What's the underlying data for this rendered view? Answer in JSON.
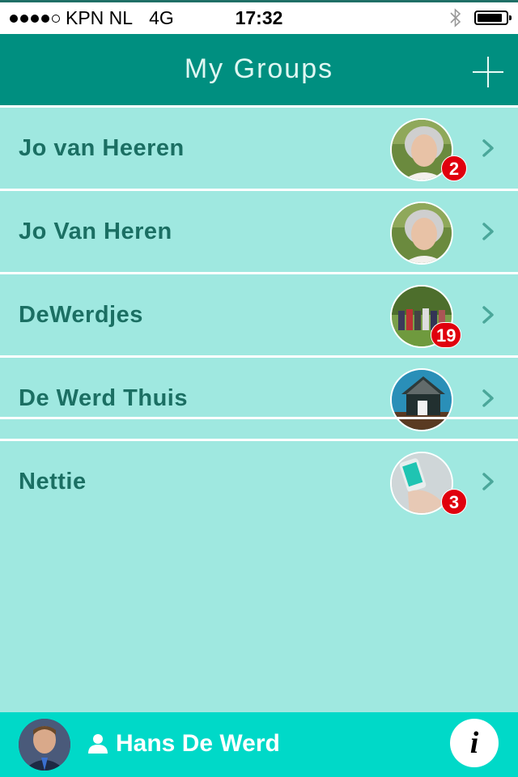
{
  "status_bar": {
    "carrier": "KPN NL",
    "network": "4G",
    "time": "17:32",
    "signal_bars_filled": 4,
    "signal_bars_total": 5,
    "bluetooth_icon": "bluetooth-icon",
    "battery_level": 0.8
  },
  "nav": {
    "title": "My Groups",
    "add_icon": "plus-icon"
  },
  "groups": [
    {
      "name": "Jo van Heeren",
      "badge": "2",
      "avatar": "woman-portrait"
    },
    {
      "name": "Jo Van Heren",
      "badge": "",
      "avatar": "woman-portrait"
    },
    {
      "name": "DeWerdjes",
      "badge": "19",
      "avatar": "family-photo"
    },
    {
      "name": "De Werd Thuis",
      "badge": "",
      "avatar": "house-photo"
    },
    {
      "name": "Nettie",
      "badge": "3",
      "avatar": "phone-hand-photo"
    }
  ],
  "user": {
    "name": "Hans De Werd",
    "avatar": "man-portrait",
    "icon": "person-icon"
  },
  "info_button": {
    "label": "i"
  },
  "colors": {
    "nav_bg": "#008f80",
    "list_bg": "#9fe8e0",
    "name_text": "#1b6f63",
    "badge": "#e0000d",
    "bottom_bar": "#00d9c8"
  }
}
